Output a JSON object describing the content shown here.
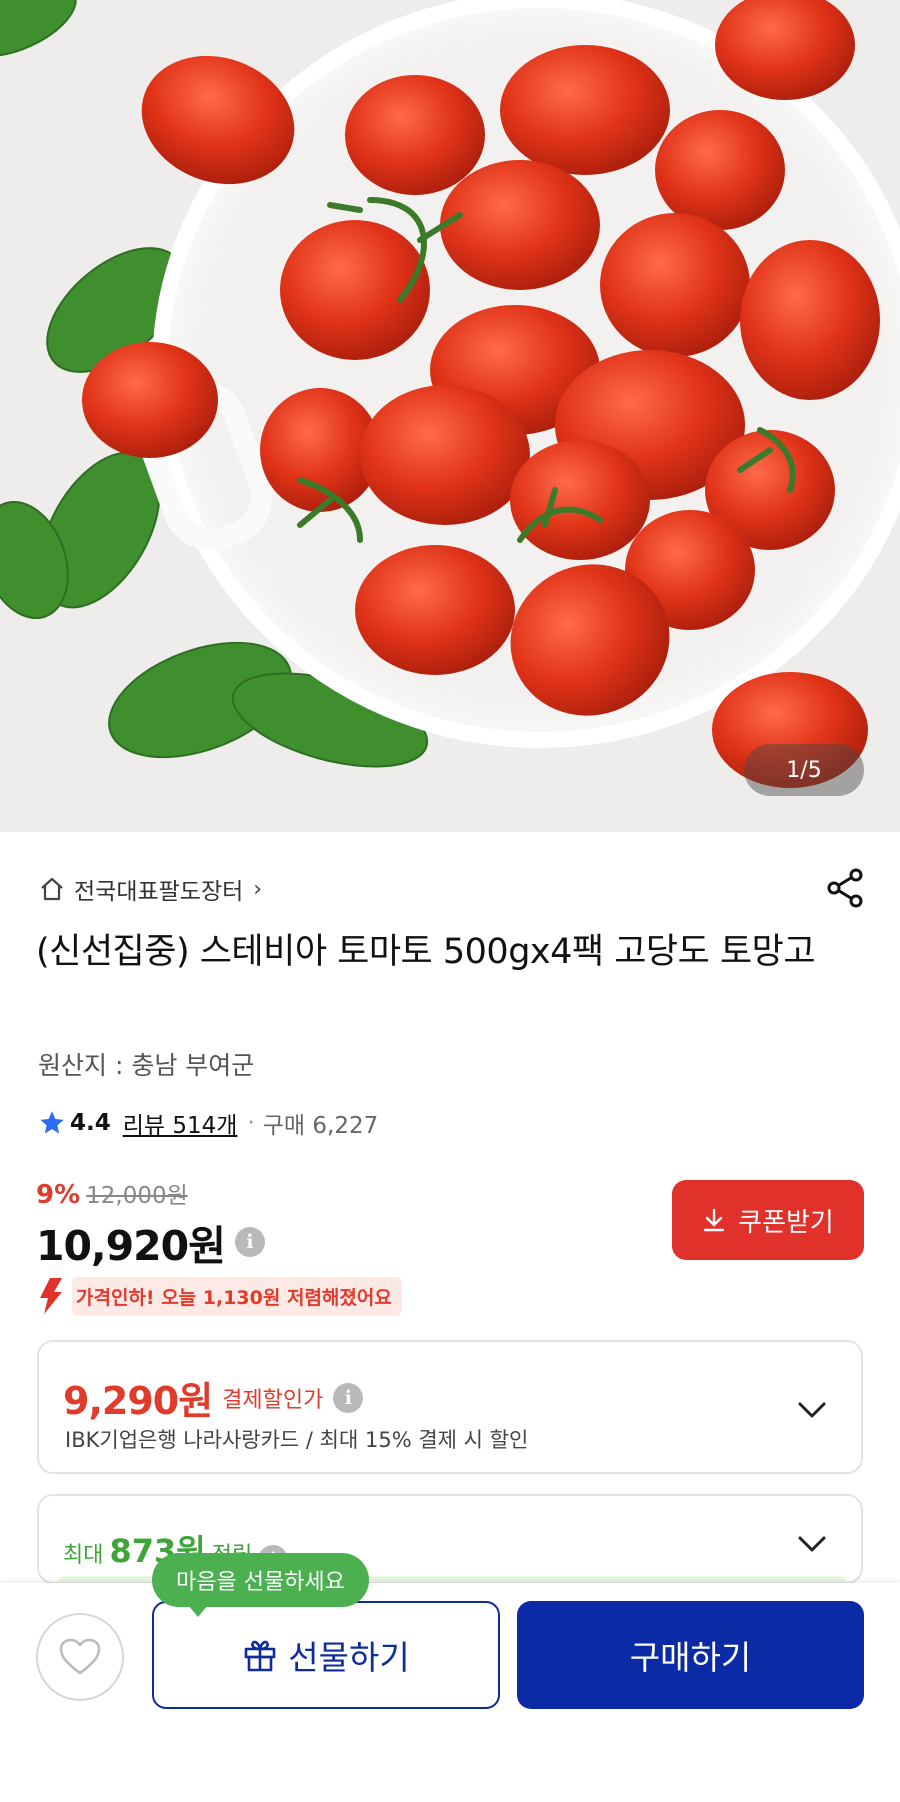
{
  "gallery": {
    "counter": "1/5",
    "image_subject": "tomatoes-in-bowl"
  },
  "store": {
    "name": "전국대표팔도장터",
    "chevron": "›",
    "home_icon": "home-icon",
    "share_icon": "share-icon"
  },
  "product": {
    "title": "(신선집중) 스테비아 토마토 500gx4팩  고당도 토망고",
    "origin": "원산지 : 충남 부여군"
  },
  "rating": {
    "star_icon": "star-icon",
    "value": "4.4",
    "reviews": "리뷰 514개",
    "separator": "·",
    "purchases": "구매 6,227"
  },
  "pricing": {
    "discount_rate": "9%",
    "original_price": "12,000원",
    "price": "10,920원",
    "info": "i",
    "coupon_label": "쿠폰받기",
    "price_drop_message": "가격인하! 오늘 1,130원 저렴해졌어요"
  },
  "payment_discount": {
    "price": "9,290원",
    "label": "결제할인가",
    "info": "i",
    "detail": "IBK기업은행 나라사랑카드 / 최대 15% 결제 시 할인"
  },
  "points": {
    "prefix": "최대",
    "amount": "873원",
    "suffix": "적립",
    "info": "i"
  },
  "bottom_bar": {
    "tooltip": "마음을 선물하세요",
    "gift_label": "선물하기",
    "buy_label": "구매하기",
    "like_icon": "heart-icon"
  },
  "colors": {
    "accent_red": "#e03b2b",
    "buy_navy": "#0b2aa6",
    "points_green": "#3fa539",
    "tooltip_green": "#4caf50"
  }
}
